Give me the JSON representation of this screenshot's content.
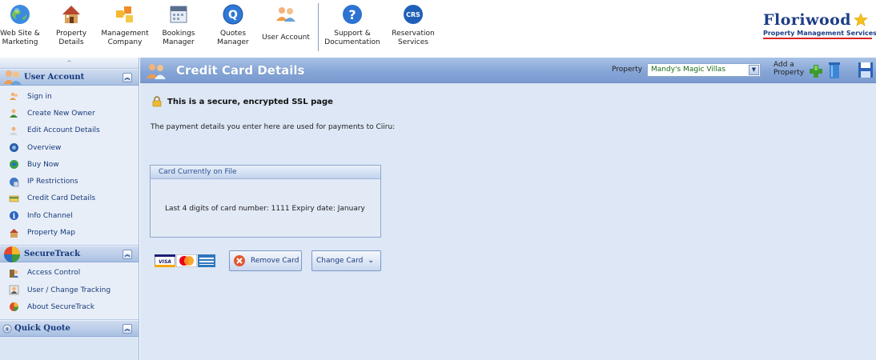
{
  "toolbar": {
    "items": [
      {
        "label": "Web Site &\nMarketing",
        "icon": "globe-icon"
      },
      {
        "label": "Property\nDetails",
        "icon": "house-icon"
      },
      {
        "label": "Management\nCompany",
        "icon": "puzzle-icon"
      },
      {
        "label": "Bookings\nManager",
        "icon": "calendar-icon"
      },
      {
        "label": "Quotes\nManager",
        "icon": "quote-q-icon"
      },
      {
        "label": "User Account",
        "icon": "users-icon"
      },
      {
        "label": "Support &\nDocumentation",
        "icon": "help-icon"
      },
      {
        "label": "Reservation\nServices",
        "icon": "crs-icon",
        "icon_text": "CRS"
      }
    ]
  },
  "logo": {
    "name": "Floriwood",
    "tagline": "Property Management Services",
    "color": "#1d3d86",
    "underline_color": "#dd2222"
  },
  "sidebar": {
    "collapse_glyph": "^",
    "sections": [
      {
        "title": "User Account",
        "icon": "users-icon",
        "items": [
          {
            "label": "Sign in",
            "icon": "user-sign-in-icon"
          },
          {
            "label": "Create New Owner",
            "icon": "user-add-icon"
          },
          {
            "label": "Edit Account Details",
            "icon": "user-edit-icon"
          },
          {
            "label": "Overview",
            "icon": "overview-icon"
          },
          {
            "label": "Buy Now",
            "icon": "buy-now-icon"
          },
          {
            "label": "IP Restrictions",
            "icon": "ip-restrictions-icon"
          },
          {
            "label": "Credit Card Details",
            "icon": "credit-card-icon"
          },
          {
            "label": "Info Channel",
            "icon": "info-icon"
          },
          {
            "label": "Property Map",
            "icon": "map-icon"
          }
        ]
      },
      {
        "title": "SecureTrack",
        "icon": "securetrack-icon",
        "items": [
          {
            "label": "Access Control",
            "icon": "access-control-icon"
          },
          {
            "label": "User / Change Tracking",
            "icon": "change-tracking-icon"
          },
          {
            "label": "About SecureTrack",
            "icon": "about-securetrack-icon"
          }
        ]
      },
      {
        "title": "Quick Quote",
        "icon": "quick-quote-icon",
        "items": []
      }
    ]
  },
  "page": {
    "title": "Credit Card Details",
    "property_label": "Property",
    "property_selected": "Mandy's Magic Villas",
    "add_property_label": "Add a\nProperty",
    "secure_notice": "This is a secure, encrypted SSL page",
    "intro_text": "The payment details you enter here are used for payments to Ciiru:",
    "card_panel": {
      "title": "Card Currently on File",
      "details": "Last 4 digits of card number: 1111 Expiry date: January"
    },
    "card_logos": [
      "VISA",
      "MasterCard",
      "AMEX"
    ],
    "remove_button": "Remove Card",
    "change_button": "Change Card"
  },
  "colors": {
    "header_blue": "#84a4d6",
    "panel_bg": "#dde7f5",
    "sidebar_text": "#163a7a",
    "link_green": "#1a6b1a"
  }
}
